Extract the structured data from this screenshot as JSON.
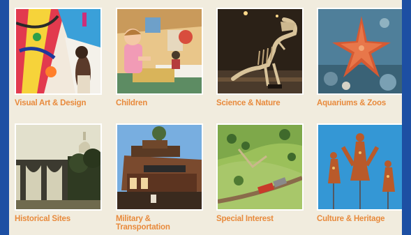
{
  "categories": [
    {
      "label": "Visual Art & Design",
      "image_icon": "street-art-mural-image"
    },
    {
      "label": "Children",
      "image_icon": "child-reading-image"
    },
    {
      "label": "Science & Nature",
      "image_icon": "dinosaur-skeleton-image"
    },
    {
      "label": "Aquariums & Zoos",
      "image_icon": "starfish-image"
    },
    {
      "label": "Historical Sites",
      "image_icon": "aqueduct-bridge-image"
    },
    {
      "label": "Military & Transportation",
      "image_icon": "transport-museum-image"
    },
    {
      "label": "Special Interest",
      "image_icon": "model-railroad-image"
    },
    {
      "label": "Culture & Heritage",
      "image_icon": "shadow-puppets-image"
    }
  ],
  "colors": {
    "frame": "#1d4fa3",
    "panel": "#f1ecde",
    "label": "#e88a3c",
    "thumb_border": "#ffffff"
  }
}
